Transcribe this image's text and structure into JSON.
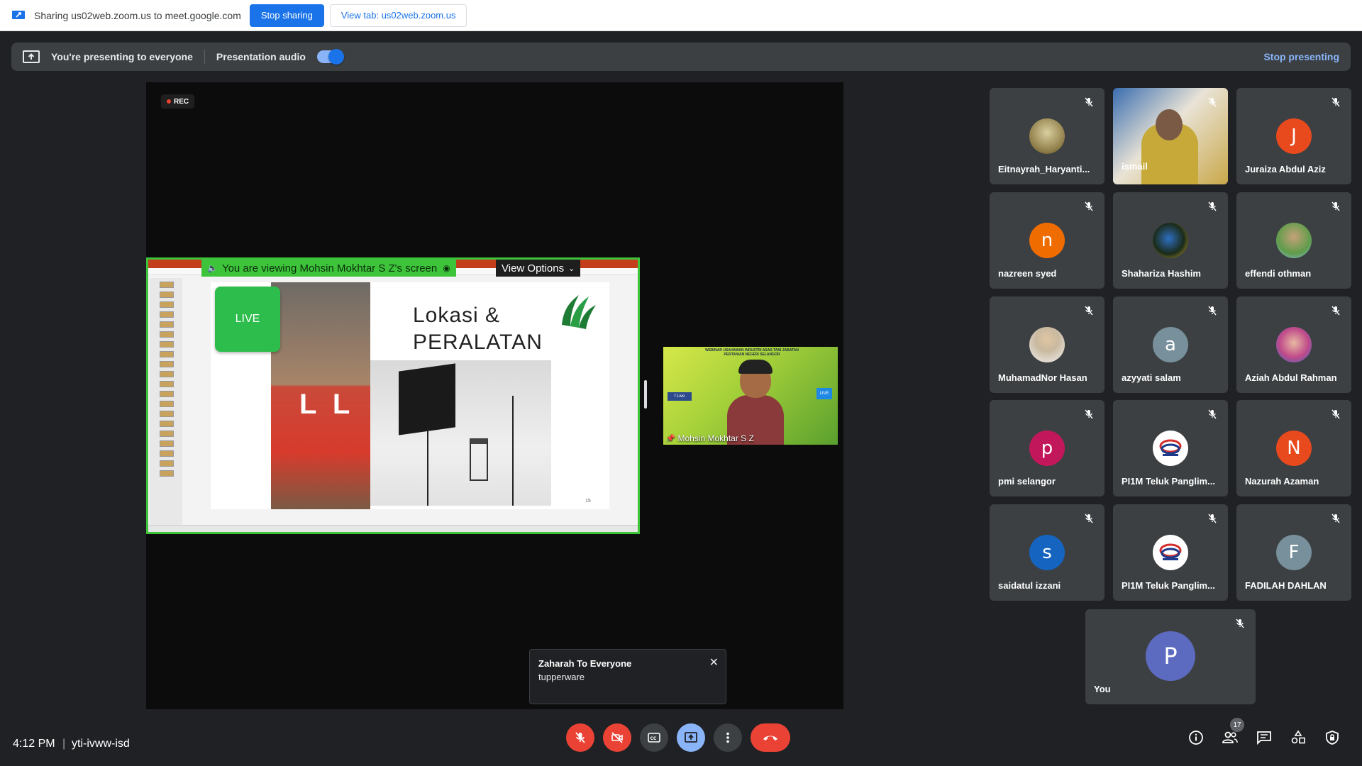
{
  "share_bar": {
    "text": "Sharing us02web.zoom.us to meet.google.com",
    "stop_label": "Stop sharing",
    "view_tab_label": "View tab: us02web.zoom.us"
  },
  "present_bar": {
    "presenting_text": "You're presenting to everyone",
    "audio_label": "Presentation audio",
    "audio_on": true,
    "stop_label": "Stop presenting"
  },
  "recording": {
    "label": "REC"
  },
  "zoom_share": {
    "banner": "You are viewing Mohsin Mokhtar S Z's screen",
    "view_options": "View Options",
    "slide": {
      "live_label": "LIVE",
      "title_line1": "Lokasi &",
      "title_line2": "PERALATAN",
      "page_num": "15"
    }
  },
  "speaker": {
    "name": "Mohsin Mokhtar S Z",
    "banner": "WEBINAR USAHAWAN INDUSTRI ASAS TANI JABATAN PERTANIAN NEGERI SELANGOR",
    "fb_label": "f Live",
    "live_label": "LIVE"
  },
  "chat_toast": {
    "sender": "Zaharah To Everyone",
    "message": "tupperware"
  },
  "participants": [
    {
      "name": "Eitnayrah_Haryanti...",
      "avatar": "photo-group",
      "color": "#b7a36a"
    },
    {
      "name": "ismail",
      "avatar": "video",
      "color": "#5a7fb0"
    },
    {
      "name": "Juraiza Abdul Aziz",
      "avatar": "J",
      "color": "#e8491d"
    },
    {
      "name": "nazreen syed",
      "avatar": "n",
      "color": "#ef6c00"
    },
    {
      "name": "Shahariza Hashim",
      "avatar": "photo-dark",
      "color": "#2a3b2a"
    },
    {
      "name": "effendi othman",
      "avatar": "photo-outdoor",
      "color": "#6aa3c8"
    },
    {
      "name": "MuhamadNor Hasan",
      "avatar": "photo-man",
      "color": "#b9b2a5"
    },
    {
      "name": "azyyati salam",
      "avatar": "a",
      "color": "#78909c"
    },
    {
      "name": "Aziah Abdul Rahman",
      "avatar": "photo-woman",
      "color": "#5a86c9"
    },
    {
      "name": "pmi selangor",
      "avatar": "p",
      "color": "#c2185b"
    },
    {
      "name": "PI1M Teluk Panglim...",
      "avatar": "logo",
      "color": "#ffffff"
    },
    {
      "name": "Nazurah Azaman",
      "avatar": "N",
      "color": "#e8491d"
    },
    {
      "name": "saidatul izzani",
      "avatar": "s",
      "color": "#1565c0"
    },
    {
      "name": "PI1M Teluk Panglim...",
      "avatar": "logo",
      "color": "#ffffff"
    },
    {
      "name": "FADILAH DAHLAN",
      "avatar": "F",
      "color": "#78909c"
    },
    {
      "name": "You",
      "avatar": "P",
      "color": "#5c6bc0"
    }
  ],
  "bottom_bar": {
    "time": "4:12 PM",
    "separator": "|",
    "meeting_code": "yti-ivww-isd",
    "people_count": "17"
  },
  "colors": {
    "accent": "#1a73e8",
    "danger": "#ea4335",
    "share_green": "#3ec43b",
    "background": "#202124"
  }
}
